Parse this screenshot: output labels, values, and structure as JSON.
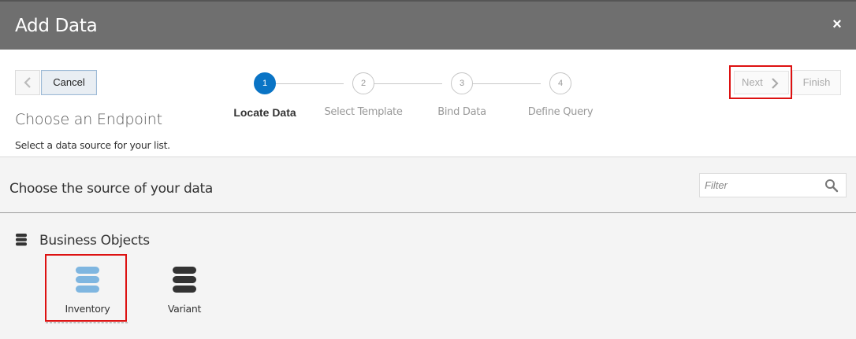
{
  "dialog": {
    "title": "Add Data",
    "close_glyph": "×"
  },
  "toolbar": {
    "cancel_label": "Cancel",
    "next_label": "Next",
    "finish_label": "Finish"
  },
  "endpoint": {
    "title": "Choose an Endpoint",
    "subtitle": "Select a data source for your list."
  },
  "steps": [
    {
      "number": "1",
      "label": "Locate Data",
      "active": true
    },
    {
      "number": "2",
      "label": "Select Template",
      "active": false
    },
    {
      "number": "3",
      "label": "Bind Data",
      "active": false
    },
    {
      "number": "4",
      "label": "Define Query",
      "active": false
    }
  ],
  "source": {
    "title": "Choose the source of your data",
    "filter_placeholder": "Filter"
  },
  "business_objects": {
    "title": "Business Objects",
    "items": [
      {
        "label": "Inventory",
        "icon": "database-icon",
        "color": "#7fb6e0",
        "selected": true
      },
      {
        "label": "Variant",
        "icon": "database-icon",
        "color": "#333333",
        "selected": false
      }
    ]
  },
  "colors": {
    "accent": "#0a74c5",
    "highlight": "#dd1111",
    "titlebar": "#6f6f6f"
  }
}
